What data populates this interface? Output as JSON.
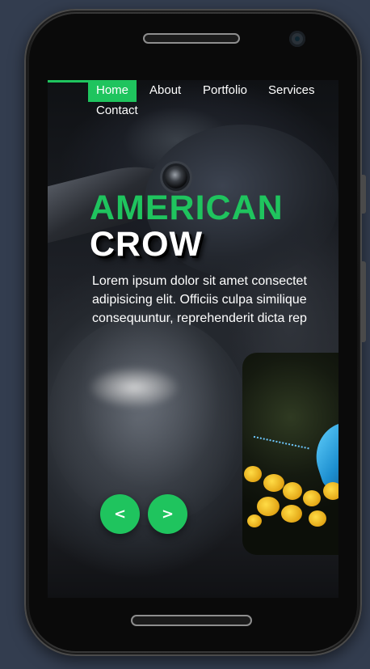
{
  "nav": {
    "items": [
      "Home",
      "About",
      "Portfolio",
      "Services",
      "Contact"
    ],
    "active": "Home"
  },
  "hero": {
    "title_line1": "AMERICAN",
    "title_line2": "CROW",
    "description_lines": [
      "Lorem ipsum dolor sit amet consectet",
      "adipisicing elit. Officiis culpa similique",
      "consequuntur, reprehenderit dicta rep"
    ]
  },
  "slider": {
    "prev_icon": "chevron-left-icon",
    "next_icon": "chevron-right-icon",
    "prev_glyph": "<",
    "next_glyph": ">"
  },
  "colors": {
    "accent": "#1fc45e",
    "page_background": "#333d4f",
    "text": "#ffffff"
  }
}
